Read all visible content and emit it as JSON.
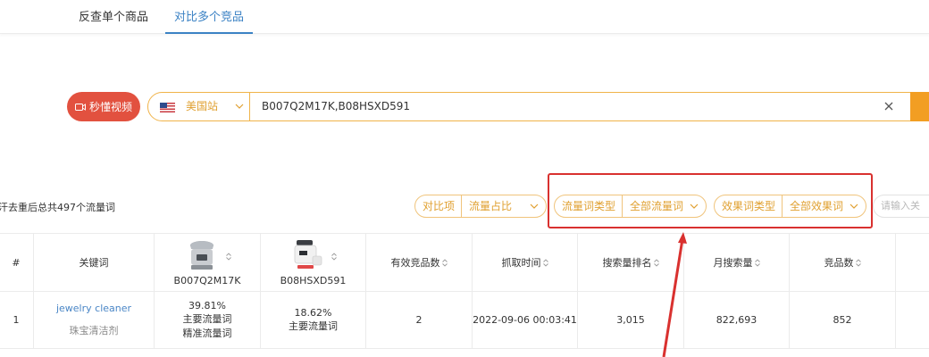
{
  "tabs": [
    {
      "label": "反查单个商品",
      "active": false
    },
    {
      "label": "对比多个竞品",
      "active": true
    }
  ],
  "colors": {
    "accent": "#3b82c4",
    "orange": "#f0b349",
    "video_button": "#e2513f",
    "highlight": "#d9312f"
  },
  "video_button": {
    "label": "秒懂视频",
    "icon": "video-camera-icon"
  },
  "search": {
    "site": "美国站",
    "flag_icon": "us-flag-icon",
    "query": "B007Q2M17K,B08HSXD591",
    "clear_icon": "close-icon"
  },
  "summary": "汗去重后总共497个流量词",
  "filters": {
    "compare": {
      "label": "对比项",
      "value": "流量占比"
    },
    "traffic_type": {
      "label": "流量词类型",
      "value": "全部流量词"
    },
    "effect_type": {
      "label": "效果词类型",
      "value": "全部效果词"
    },
    "input_placeholder": "请输入关"
  },
  "table": {
    "headers": {
      "index": "#",
      "keyword": "关键词",
      "product1": "B007Q2M17K",
      "product2": "B08HSXD591",
      "effective_count": "有效竞品数",
      "crawl_time": "抓取时间",
      "search_rank": "搜索量排名",
      "monthly_search": "月搜索量",
      "product_count": "竞品数"
    },
    "rows": [
      {
        "index": "1",
        "keyword": "jewelry cleaner",
        "keyword_cn": "珠宝清洁剂",
        "p1_share": "39.81%",
        "p1_type1": "主要流量词",
        "p1_type2": "精准流量词",
        "p2_share": "18.62%",
        "p2_type1": "主要流量词",
        "effective_count": "2",
        "crawl_time": "2022-09-06 00:03:41",
        "search_rank": "3,015",
        "monthly_search": "822,693",
        "product_count": "852"
      }
    ]
  }
}
